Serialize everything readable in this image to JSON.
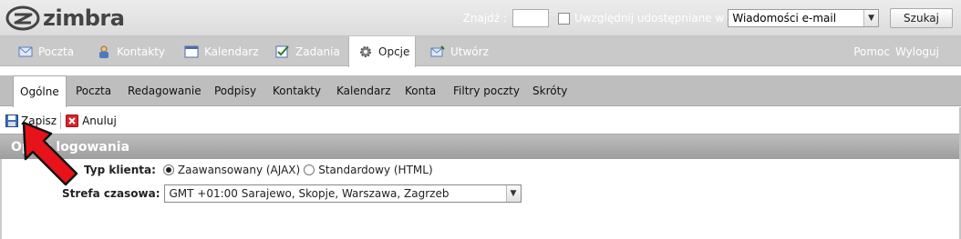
{
  "header": {
    "logo": "zimbra",
    "find_label": "Znajdź :",
    "find_value": "",
    "include_shared_label": "Uwzględnij udostępniane w",
    "search_scope": "Wiadomości e-mail",
    "search_button": "Szukaj"
  },
  "app_tabs": [
    {
      "label": "Poczta",
      "icon": "mail-icon"
    },
    {
      "label": "Kontakty",
      "icon": "contacts-icon"
    },
    {
      "label": "Kalendarz",
      "icon": "calendar-icon"
    },
    {
      "label": "Zadania",
      "icon": "tasks-icon"
    },
    {
      "label": "Opcje",
      "icon": "gear-icon",
      "active": true
    },
    {
      "label": "Utwórz",
      "icon": "compose-icon"
    }
  ],
  "right_links": {
    "help": "Pomoc",
    "logout": "Wyloguj"
  },
  "sub_tabs": [
    "Ogólne",
    "Poczta",
    "Redagowanie",
    "Podpisy",
    "Kontakty",
    "Kalendarz",
    "Konta",
    "Filtry poczty",
    "Skróty"
  ],
  "toolbar": {
    "save": "Zapisz",
    "cancel": "Anuluj"
  },
  "section": {
    "title": "Opcje logowania",
    "client_type_label": "Typ klienta:",
    "client_options": [
      "Zaawansowany (AJAX)",
      "Standardowy (HTML)"
    ],
    "client_selected": "Zaawansowany (AJAX)",
    "timezone_label": "Strefa czasowa:",
    "timezone_value": "GMT +01:00 Sarajewo, Skopje, Warszawa, Zagrzeb"
  },
  "colors": {
    "annotation_arrow": "#e8121a",
    "tab_bar": "#c9c9c9",
    "section_header": "#a8a8a8"
  }
}
